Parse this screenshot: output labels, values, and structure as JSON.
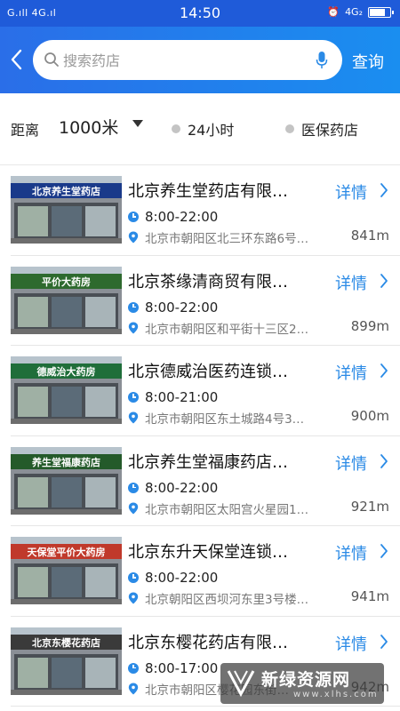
{
  "status_bar": {
    "signal_left": "G.ıll 4G.ıl",
    "time": "14:50",
    "network_right": "4G₂"
  },
  "header": {
    "search_placeholder": "搜索药店",
    "query_label": "查询"
  },
  "filters": {
    "distance_label": "距离",
    "distance_value": "1000米",
    "option_24h": "24小时",
    "option_insurance": "医保药店"
  },
  "list_common": {
    "detail_label": "详情"
  },
  "pharmacies": [
    {
      "name": "北京养生堂药店有限…",
      "hours": "8:00-22:00",
      "address": "北京市朝阳区北三环东路6号…",
      "distance": "841m",
      "sign_text": "北京养生堂药店",
      "sign_color": "#1a3a8a"
    },
    {
      "name": "北京茶缘清商贸有限…",
      "hours": "8:00-22:00",
      "address": "北京市朝阳区和平街十三区2…",
      "distance": "899m",
      "sign_text": "平价大药房",
      "sign_color": "#2e6a2e"
    },
    {
      "name": "北京德威治医药连锁…",
      "hours": "8:00-21:00",
      "address": "北京市朝阳区东土城路4号3…",
      "distance": "900m",
      "sign_text": "德威治大药房",
      "sign_color": "#1f6e3a"
    },
    {
      "name": "北京养生堂福康药店…",
      "hours": "8:00-22:00",
      "address": "北京市朝阳区太阳宫火星园1…",
      "distance": "921m",
      "sign_text": "养生堂福康药店",
      "sign_color": "#245a2a"
    },
    {
      "name": "北京东升天保堂连锁…",
      "hours": "8:00-22:00",
      "address": "北京朝阳区西坝河东里3号楼…",
      "distance": "941m",
      "sign_text": "天保堂平价大药房",
      "sign_color": "#c0392b"
    },
    {
      "name": "北京东樱花药店有限…",
      "hours": "8:00-17:00",
      "address": "北京市朝阳区樱花园东街…",
      "distance": "942m",
      "sign_text": "北京东樱花药店",
      "sign_color": "#3a3a3a"
    }
  ],
  "watermark": {
    "title": "新绿资源网",
    "subtitle": "www.xlhs.com"
  },
  "colors": {
    "brand_blue": "#2a6ee8",
    "accent_blue": "#2a8ae6"
  }
}
